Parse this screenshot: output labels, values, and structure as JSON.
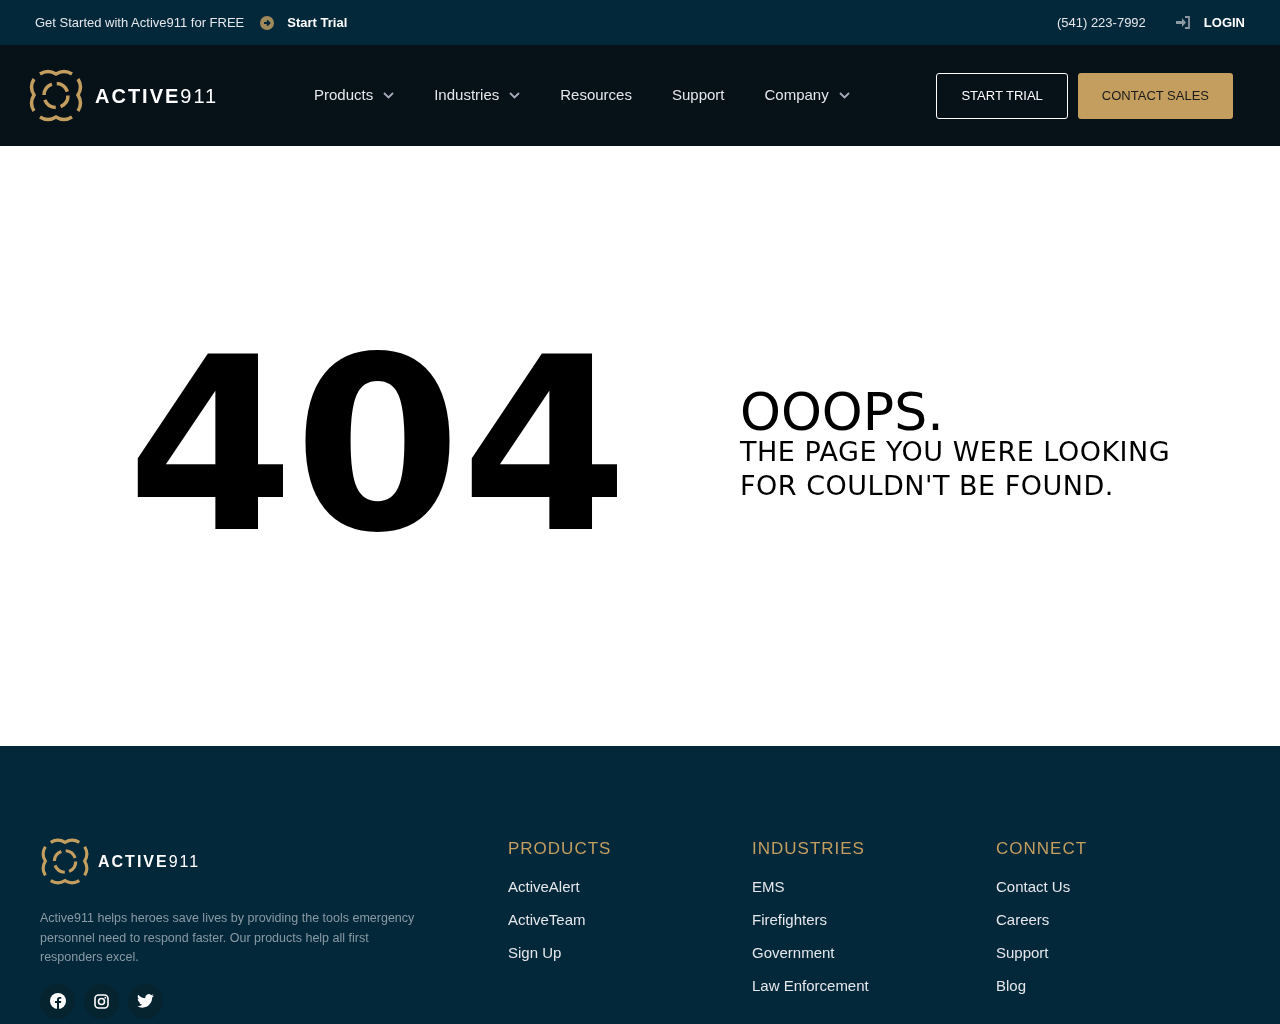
{
  "top_bar": {
    "promo": "Get Started with Active911 for FREE",
    "trial_link": "Start Trial",
    "phone": "(541) 223-7992",
    "login": "LOGIN"
  },
  "header": {
    "logo_text": "**ACTIVE**911",
    "nav": [
      {
        "label": "Products",
        "dropdown": true
      },
      {
        "label": "Industries",
        "dropdown": true
      },
      {
        "label": "Resources",
        "dropdown": false
      },
      {
        "label": "Support",
        "dropdown": false
      },
      {
        "label": "Company",
        "dropdown": true
      }
    ],
    "buttons": [
      {
        "label": "START TRIAL",
        "kind": "outline"
      },
      {
        "label": "CONTACT SALES",
        "kind": "filled"
      }
    ]
  },
  "error": {
    "code": "404",
    "title": "OOOPS.",
    "message": "THE PAGE YOU WERE LOOKING FOR COULDN'T BE FOUND."
  },
  "footer": {
    "logo_text": "**ACTIVE**911",
    "about": "Active911 helps heroes save lives by providing the tools emergency personnel need to respond faster. Our products help all first responders excel.",
    "social": [
      {
        "kind": "facebook"
      },
      {
        "kind": "instagram"
      },
      {
        "kind": "twitter"
      }
    ],
    "columns": [
      {
        "heading": "PRODUCTS",
        "links": [
          "ActiveAlert",
          "ActiveTeam",
          "Sign Up"
        ]
      },
      {
        "heading": "INDUSTRIES",
        "links": [
          "EMS",
          "Firefighters",
          "Government",
          "Law Enforcement"
        ]
      },
      {
        "heading": "CONNECT",
        "links": [
          "Contact Us",
          "Careers",
          "Support",
          "Blog"
        ]
      }
    ]
  }
}
